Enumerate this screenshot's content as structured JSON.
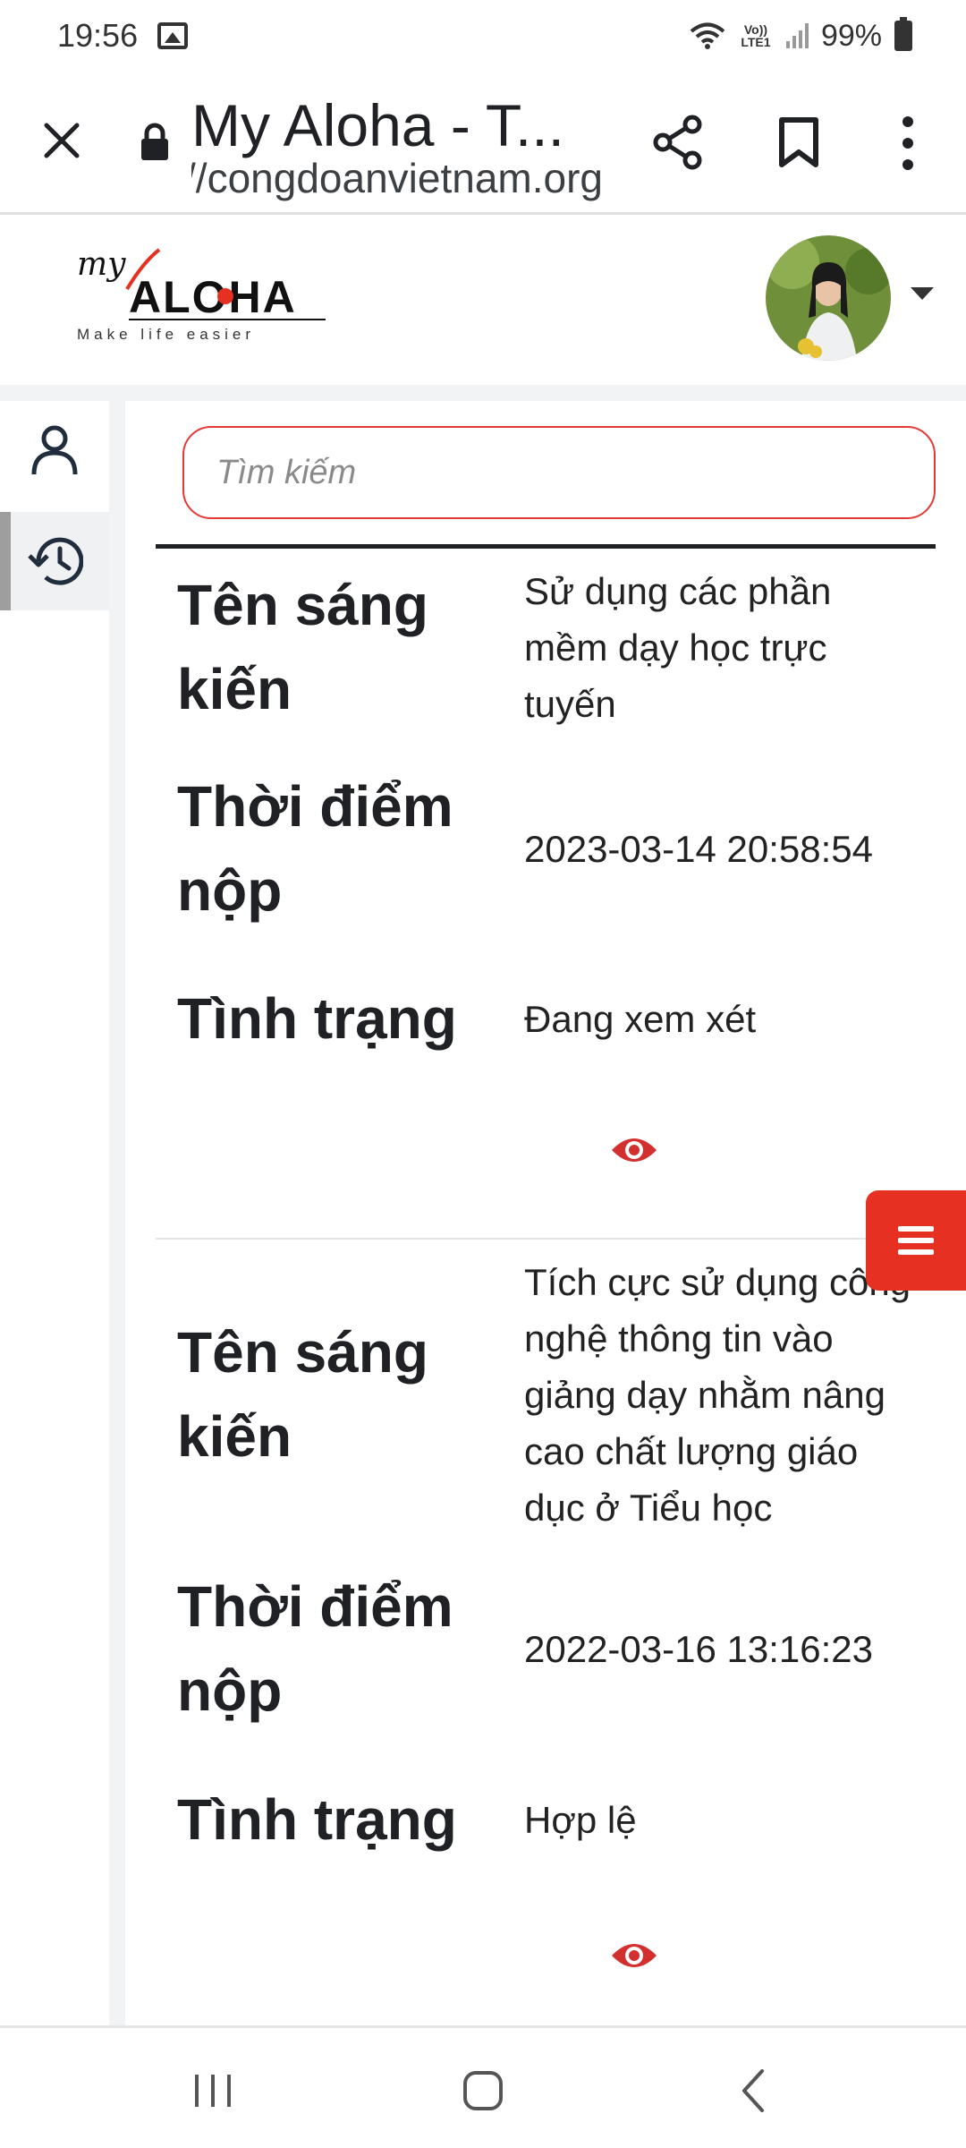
{
  "status_bar": {
    "time": "19:56",
    "network_label": "Vo)) LTE1",
    "battery": "99%"
  },
  "browser": {
    "title": "My Aloha - T...",
    "url": "https://congdoanvietnam.org",
    "icons": [
      "close-icon",
      "lock-icon",
      "share-icon",
      "bookmark-icon",
      "more-vert-icon"
    ]
  },
  "header": {
    "logo_text": "my ALOHA",
    "logo_tagline": "Make life easier"
  },
  "sidebar": {
    "items": [
      {
        "name": "profile",
        "icon": "user-icon",
        "active": false
      },
      {
        "name": "history",
        "icon": "history-icon",
        "active": true
      }
    ]
  },
  "search": {
    "placeholder": "Tìm kiếm",
    "value": ""
  },
  "records": [
    {
      "name_label": "Tên sáng kiến",
      "name_value": "Sử dụng các phần mềm dạy học trực tuyến",
      "time_label": "Thời điểm nộp",
      "time_value": "2023-03-14 20:58:54",
      "status_label": "Tình trạng",
      "status_value": "Đang xem xét"
    },
    {
      "name_label": "Tên sáng kiến",
      "name_value": "Tích cực sử dụng công nghệ thông tin vào giảng dạy nhằm nâng cao chất lượng giáo dục ở Tiểu học",
      "time_label": "Thời điểm nộp",
      "time_value": "2022-03-16 13:16:23",
      "status_label": "Tình trạng",
      "status_value": "Hợp lệ"
    }
  ],
  "colors": {
    "accent_red": "#e53022",
    "text_dark": "#202124"
  }
}
